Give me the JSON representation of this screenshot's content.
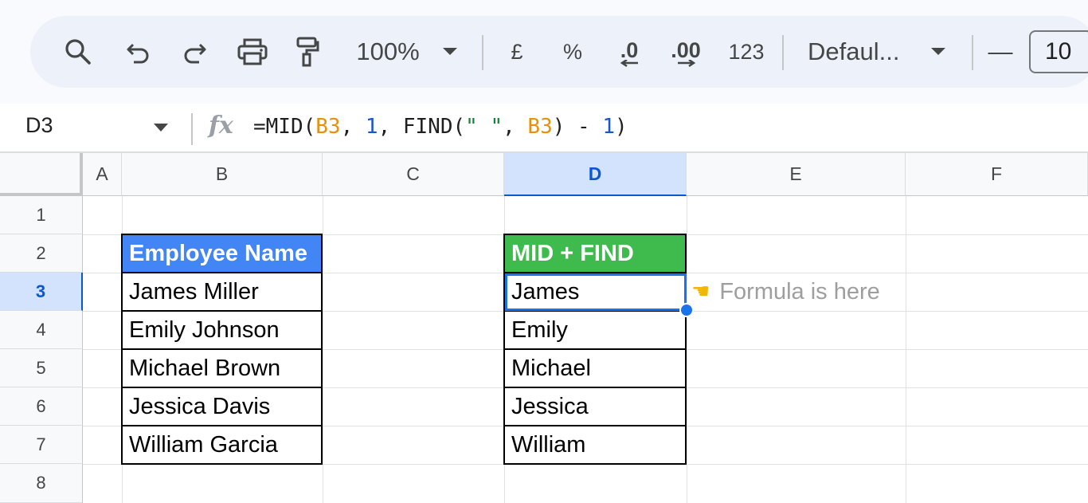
{
  "toolbar": {
    "zoom": "100%",
    "currency": "£",
    "percent": "%",
    "decrease_decimal": ".0",
    "increase_decimal": ".00",
    "number_format": "123",
    "font": "Defaul...",
    "font_size_minus": "—",
    "font_size": "10"
  },
  "formula_bar": {
    "cell_ref": "D3",
    "fx": "fx",
    "formula_parts": [
      "=MID(",
      "B3",
      ", ",
      "1",
      ", FIND(",
      "\" \"",
      ", ",
      "B3",
      ") - ",
      "1",
      ")"
    ]
  },
  "columns": [
    "A",
    "B",
    "C",
    "D",
    "E",
    "F"
  ],
  "rows": [
    "1",
    "2",
    "3",
    "4",
    "5",
    "6",
    "7",
    "8"
  ],
  "selected": {
    "column": "D",
    "row": "3"
  },
  "table_left": {
    "header": "Employee Name",
    "values": [
      "James Miller",
      "Emily Johnson",
      "Michael Brown",
      "Jessica Davis",
      "William Garcia"
    ]
  },
  "table_right": {
    "header": "MID + FIND",
    "values": [
      "James",
      "Emily",
      "Michael",
      "Jessica",
      "William"
    ]
  },
  "note": {
    "icon": "pointing-hand-icon",
    "text": "Formula is here"
  },
  "colors": {
    "left_header_bg": "#4285f4",
    "right_header_bg": "#3fba4c",
    "selection": "#1a73e8",
    "cell_ref_color": "#e8900c",
    "number_color": "#1a56c9",
    "string_color": "#188038"
  }
}
